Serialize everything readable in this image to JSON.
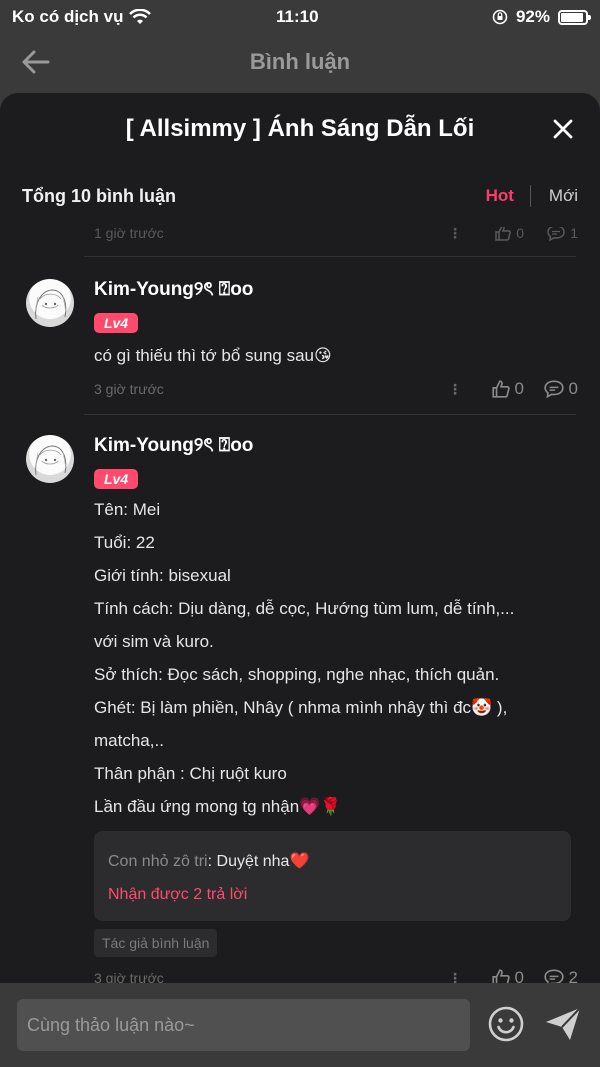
{
  "status_bar": {
    "carrier": "Ko có dịch vụ",
    "time": "11:10",
    "battery_percent": "92%",
    "battery_level": 0.92
  },
  "nav": {
    "title": "Bình luận",
    "back_icon": "arrow-left-icon"
  },
  "sheet": {
    "title": "[ Allsimmy ] Ánh Sáng Dẫn Lối",
    "close_icon": "close-icon",
    "summary": "Tổng 10 bình luận",
    "sort_hot": "Hot",
    "sort_new": "Mới"
  },
  "partial_comment": {
    "time": "1 giờ trước",
    "likes": "0",
    "replies": "1"
  },
  "comments": [
    {
      "username": "Kim-Young୨ৎ ⍰oo",
      "level": "Lv4",
      "lines": [
        "có gì thiếu thì tớ bổ sung sau😘"
      ],
      "time": "3 giờ trước",
      "likes": "0",
      "replies": "0"
    },
    {
      "username": "Kim-Young୨ৎ ⍰oo",
      "level": "Lv4",
      "lines": [
        "Tên: Mei",
        "Tuổi: 22",
        "Giới tính: bisexual",
        "Tính cách: Dịu dàng, dễ cọc, Hướng tùm lum, dễ tính,...",
        "với sim và kuro.",
        "Sở thích: Đọc sách, shopping, nghe nhạc, thích quản.",
        "Ghét: Bị làm phiền, Nhây ( nhma mình nhây thì đc🤡 ),",
        "matcha,..",
        "Thân phận : Chị ruột kuro",
        "Lần đầu ứng mong tg nhận💗🌹"
      ],
      "reply_preview": {
        "author": "Con nhỏ zô tri",
        "separator": ":",
        "text": " Duyệt nha❤️",
        "link": "Nhận được 2 trả lời"
      },
      "author_tag": "Tác giả bình luận",
      "time": "3 giờ trước",
      "likes": "0",
      "replies": "2"
    }
  ],
  "input": {
    "placeholder": "Cùng thảo luận nào~",
    "emoji_icon": "smiley-icon",
    "send_icon": "send-icon"
  },
  "colors": {
    "accent": "#ff4a6e",
    "sheet_bg": "#1c1c1e",
    "page_bg": "#3a3a3a"
  }
}
